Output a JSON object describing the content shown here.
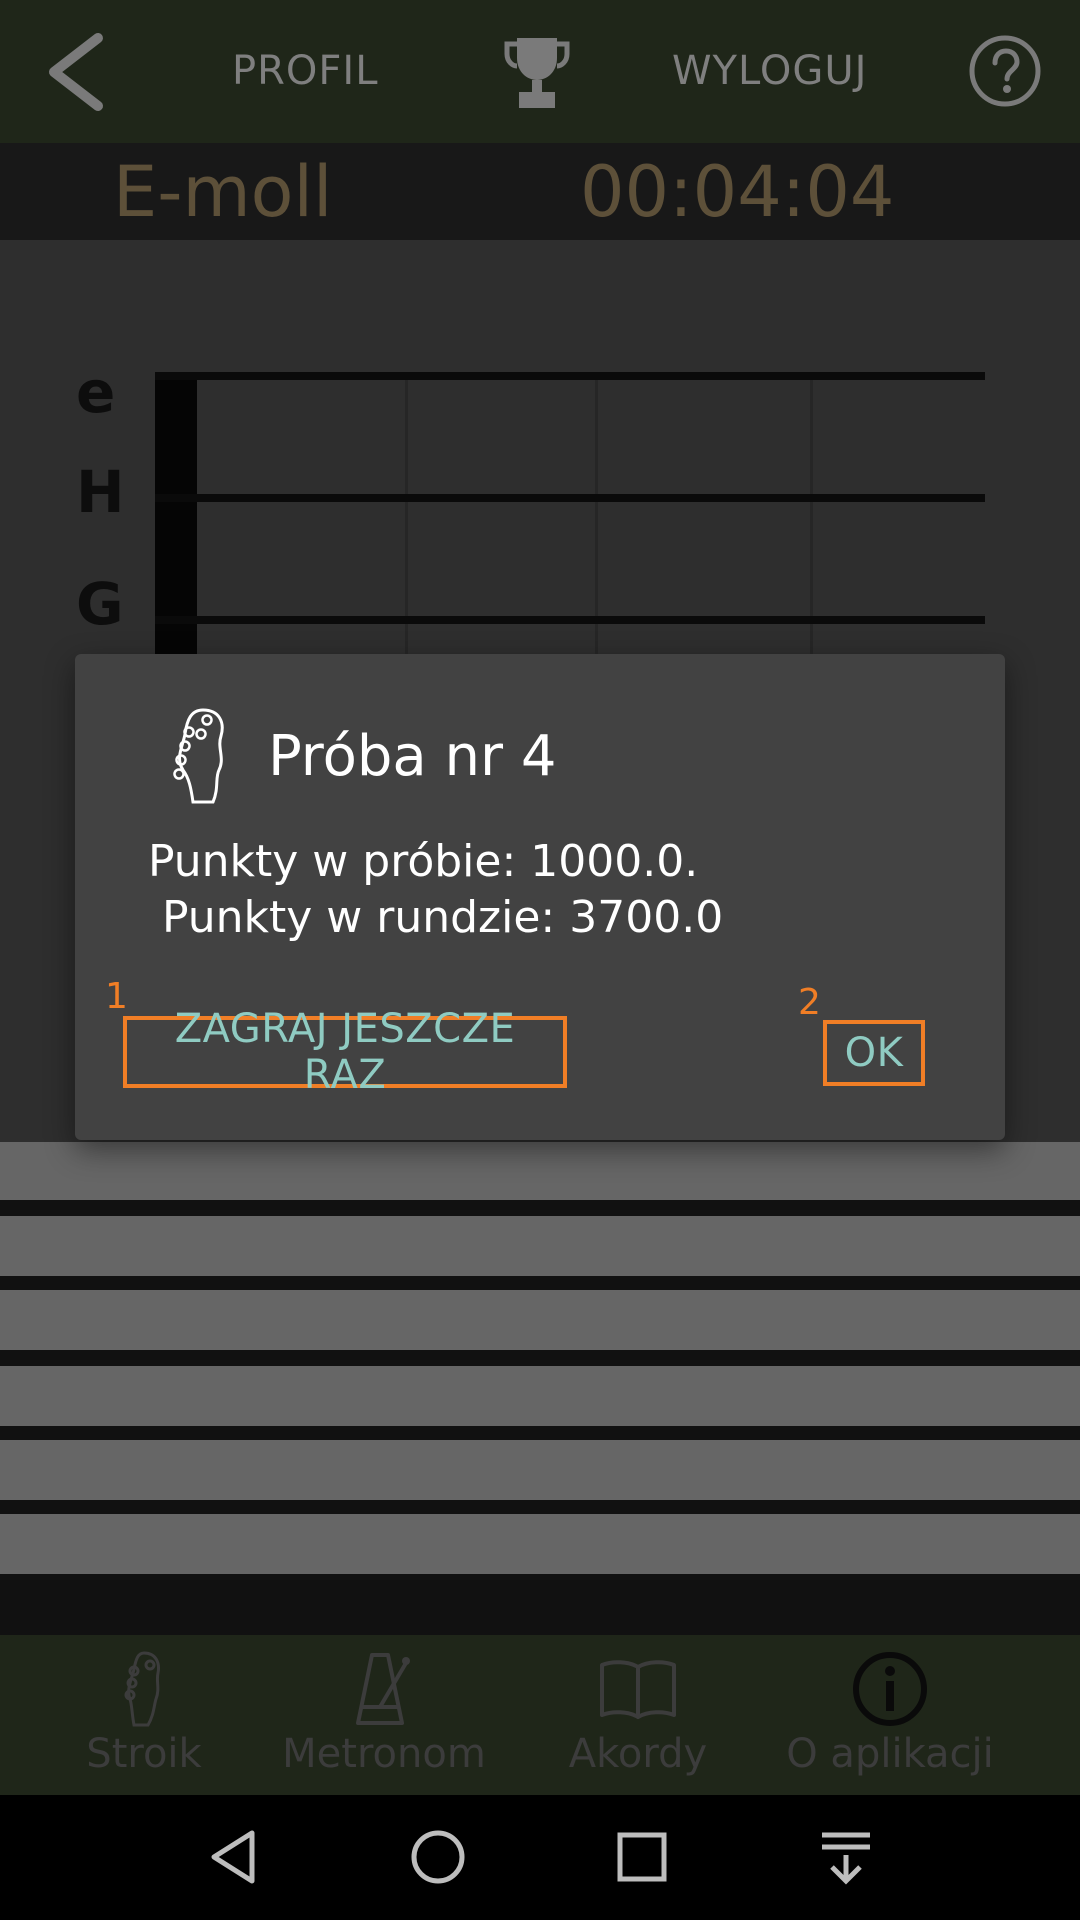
{
  "topbar": {
    "profile_label": "PROFIL",
    "logout_label": "WYLOGUJ",
    "icons": [
      "back-arrow-icon",
      "trophy-icon",
      "help-icon"
    ]
  },
  "exercise": {
    "chord": "E-moll",
    "timer": "00:04:04"
  },
  "fretboard": {
    "string_labels": [
      "e",
      "H",
      "G"
    ]
  },
  "dialog": {
    "title": "Próba nr 4",
    "message": "Punkty w próbie: 1000.0.\n Punkty w rundzie: 3700.0",
    "buttons": {
      "play_again": "ZAGRAJ JESZCZE RAZ",
      "ok": "OK"
    },
    "markers": [
      "1",
      "2"
    ],
    "icon": "guitar-headstock-icon"
  },
  "bottom_nav": {
    "items": [
      {
        "label": "Stroik",
        "icon": "tuner-headstock-icon"
      },
      {
        "label": "Metronom",
        "icon": "metronome-icon"
      },
      {
        "label": "Akordy",
        "icon": "book-icon"
      },
      {
        "label": "O aplikacji",
        "icon": "info-icon"
      }
    ]
  },
  "colors": {
    "accent_marker": "#f07e26",
    "button_text": "#8fcbc2",
    "dialog_bg": "#424242",
    "toolbar_bg": "#1f2619"
  }
}
